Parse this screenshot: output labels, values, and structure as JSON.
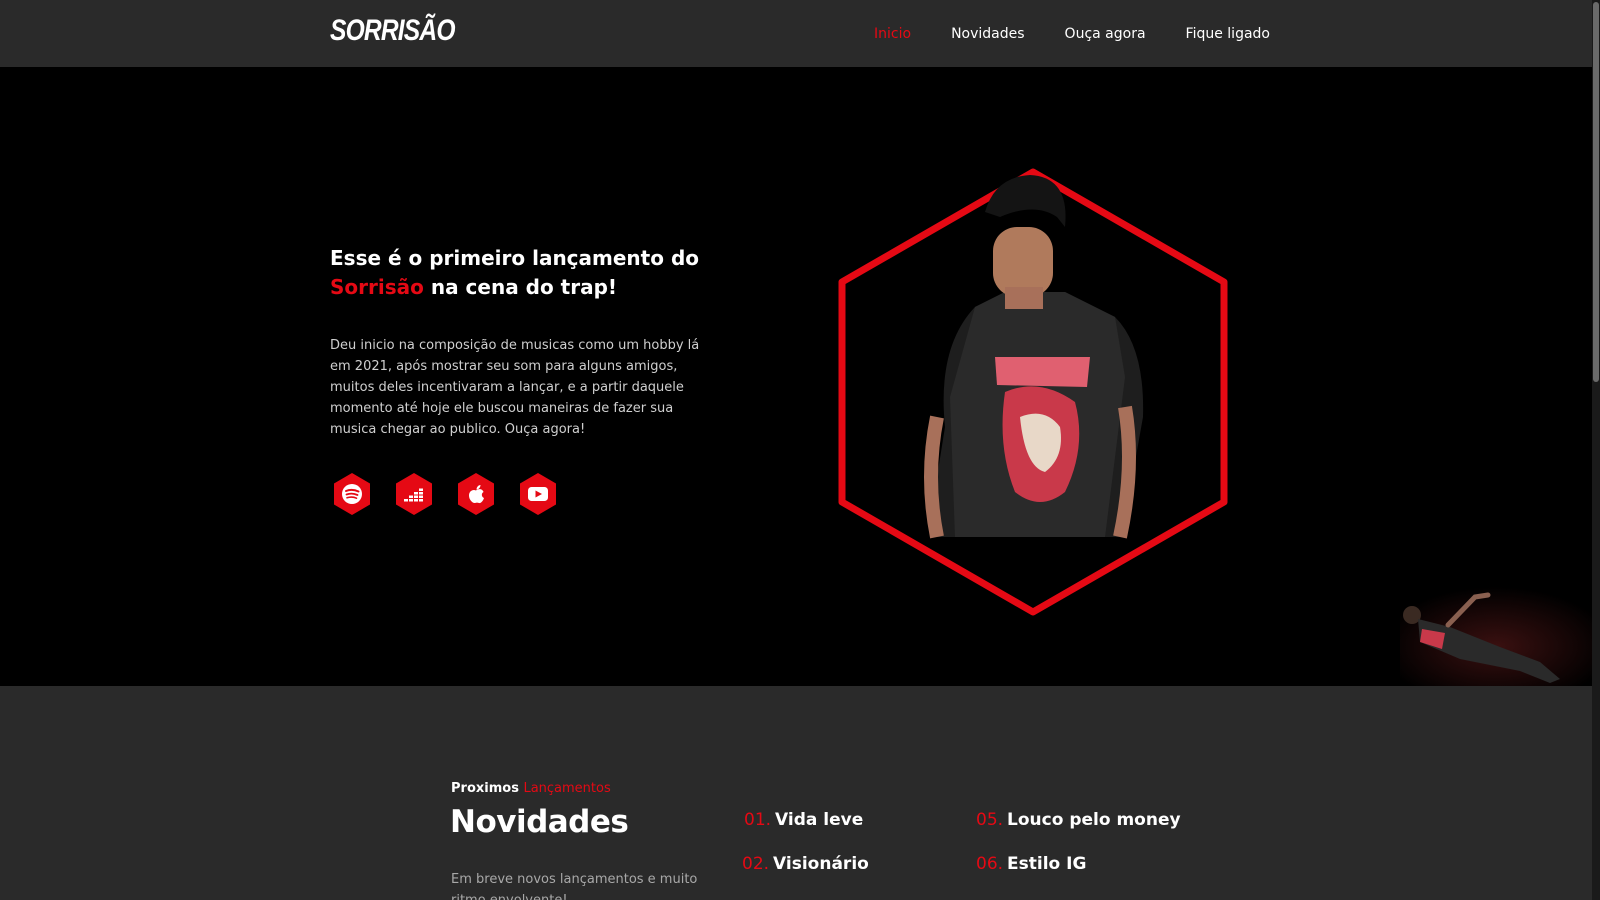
{
  "nav": {
    "logo": "SORRISÃO",
    "links": [
      "Inicio",
      "Novidades",
      "Ouça agora",
      "Fique ligado"
    ]
  },
  "hero": {
    "title_part1": "Esse é o primeiro lançamento do",
    "title_highlight": "Sorrisão",
    "title_part2": " na cena do trap!",
    "description": "Deu inicio na composição de musicas como um hobby lá em 2021, após mostrar seu som para alguns amigos, muitos deles incentivaram a lançar, e a partir daquele momento até hoje ele buscou maneiras de fazer sua musica chegar ao publico. Ouça agora!",
    "social_icons": [
      "spotify-icon",
      "deezer-icon",
      "apple-music-icon",
      "youtube-icon"
    ]
  },
  "novidades": {
    "eyebrow_plain": "Proximos ",
    "eyebrow_highlight": "Lançamentos",
    "title": "Novidades",
    "description": "Em breve novos lançamentos e muito ritmo envolvente!",
    "tracks": [
      {
        "num": "01.",
        "name": "Vida leve"
      },
      {
        "num": "02.",
        "name": "Visionário"
      },
      {
        "num": "05.",
        "name": "Louco pelo money"
      },
      {
        "num": "06.",
        "name": "Estilo IG"
      }
    ]
  },
  "colors": {
    "accent": "#e50914",
    "nav_bg": "#2a2a2a",
    "hero_bg": "#000000",
    "section_bg": "#2a2a2a"
  }
}
